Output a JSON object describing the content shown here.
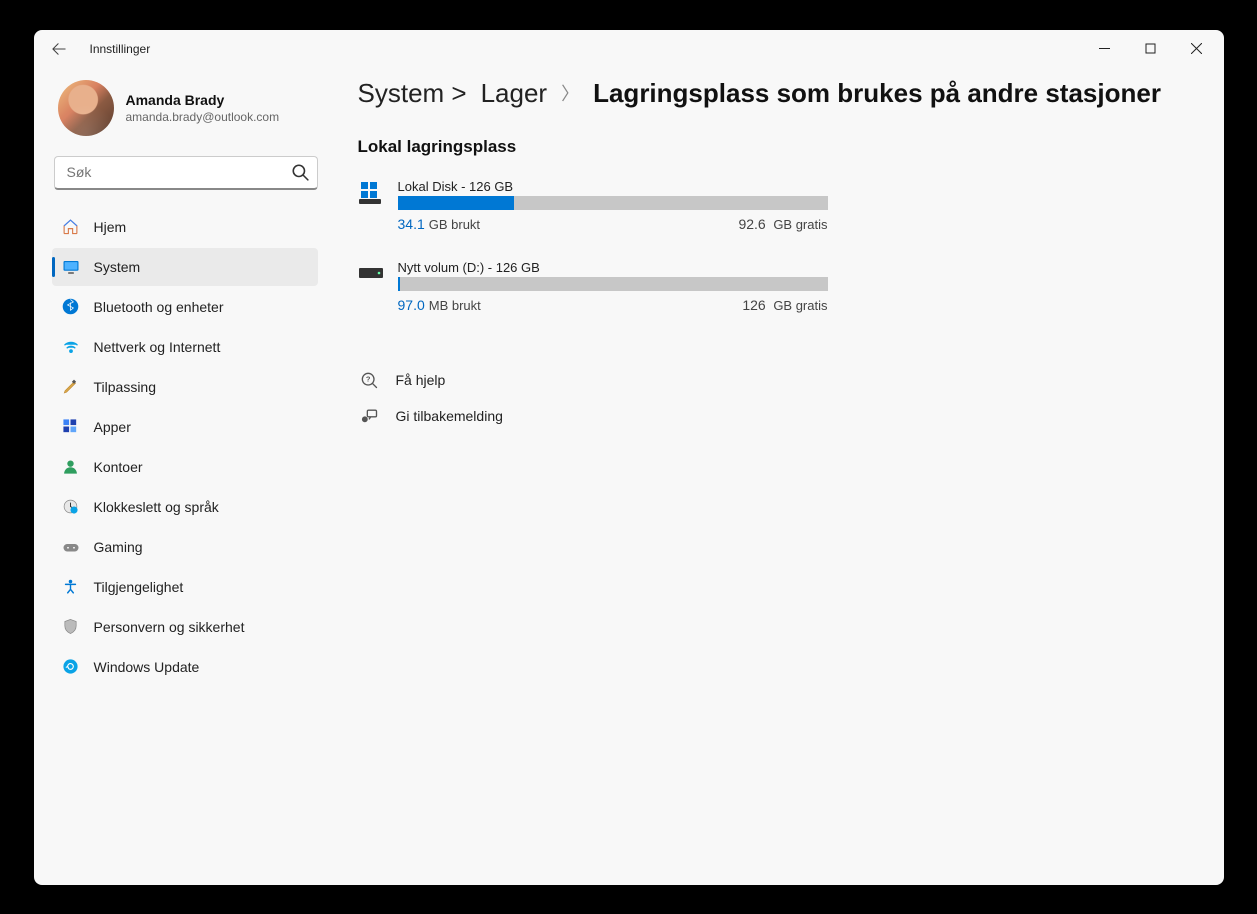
{
  "titlebar": {
    "title": "Innstillinger"
  },
  "profile": {
    "name": "Amanda Brady",
    "email": "amanda.brady@outlook.com"
  },
  "search": {
    "placeholder": "Søk"
  },
  "nav": {
    "items": [
      {
        "label": "Hjem"
      },
      {
        "label": "System"
      },
      {
        "label": "Bluetooth og enheter"
      },
      {
        "label": "Nettverk og Internett"
      },
      {
        "label": "Tilpassing"
      },
      {
        "label": "Apper"
      },
      {
        "label": "Kontoer"
      },
      {
        "label": "Klokkeslett og språk"
      },
      {
        "label": "Gaming"
      },
      {
        "label": "Tilgjengelighet"
      },
      {
        "label": "Personvern og sikkerhet"
      },
      {
        "label": "Windows Update"
      }
    ]
  },
  "breadcrumb": {
    "part1": "System >",
    "part2": "Lager",
    "part3": "Lagringsplass som brukes på andre stasjoner"
  },
  "section_title": "Lokal lagringsplass",
  "drives": [
    {
      "title": "Lokal Disk - 126 GB",
      "fill_percent": 27,
      "used_value": "34.1",
      "used_unit": "GB brukt",
      "free_value": "92.6",
      "free_unit": "GB gratis"
    },
    {
      "title": "Nytt volum (D:) - 126 GB",
      "fill_percent": 0.5,
      "used_value": "97.0",
      "used_unit": "MB brukt",
      "free_value": "126",
      "free_unit": "GB gratis"
    }
  ],
  "help": {
    "get_help": "Få hjelp",
    "feedback": "Gi tilbakemelding"
  }
}
